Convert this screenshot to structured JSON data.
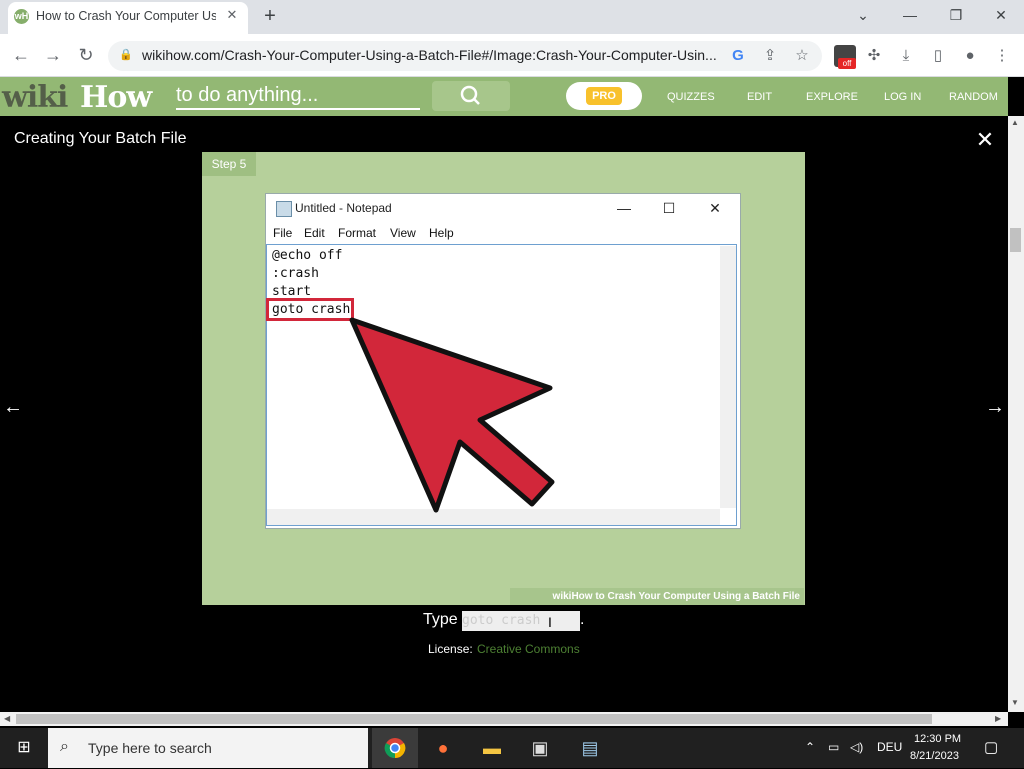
{
  "browser": {
    "tab_title": "How to Crash Your Computer Us",
    "tab_favicon": "wH",
    "new_tab_label": "+",
    "url": "wikihow.com/Crash-Your-Computer-Using-a-Batch-File#/Image:Crash-Your-Computer-Usin...",
    "extension_badge": "off"
  },
  "wikihow": {
    "logo_wiki": "wiki",
    "logo_how": "How",
    "search_placeholder": "to do anything...",
    "pro_label": "PRO",
    "nav": [
      "QUIZZES",
      "EDIT",
      "EXPLORE",
      "LOG IN",
      "RANDOM"
    ]
  },
  "lightbox": {
    "title": "Creating Your Batch File",
    "step_badge": "Step 5",
    "caption_prefix": "Type",
    "caption_code": "goto crash",
    "caption_suffix": ".",
    "license_label": "License:",
    "license_link": "Creative Commons",
    "watermark": "wikiHow to Crash Your Computer Using a Batch File"
  },
  "notepad": {
    "title": "Untitled - Notepad",
    "menu": [
      "File",
      "Edit",
      "Format",
      "View",
      "Help"
    ],
    "lines": [
      "@echo off",
      ":crash",
      "start",
      "goto crash"
    ]
  },
  "taskbar": {
    "search_placeholder": "Type here to search",
    "language": "DEU",
    "time": "12:30 PM",
    "date": "8/21/2023"
  },
  "colors": {
    "wikihow_green": "#93b874",
    "arrow_red": "#d2273a",
    "license_link": "#4d8033"
  }
}
